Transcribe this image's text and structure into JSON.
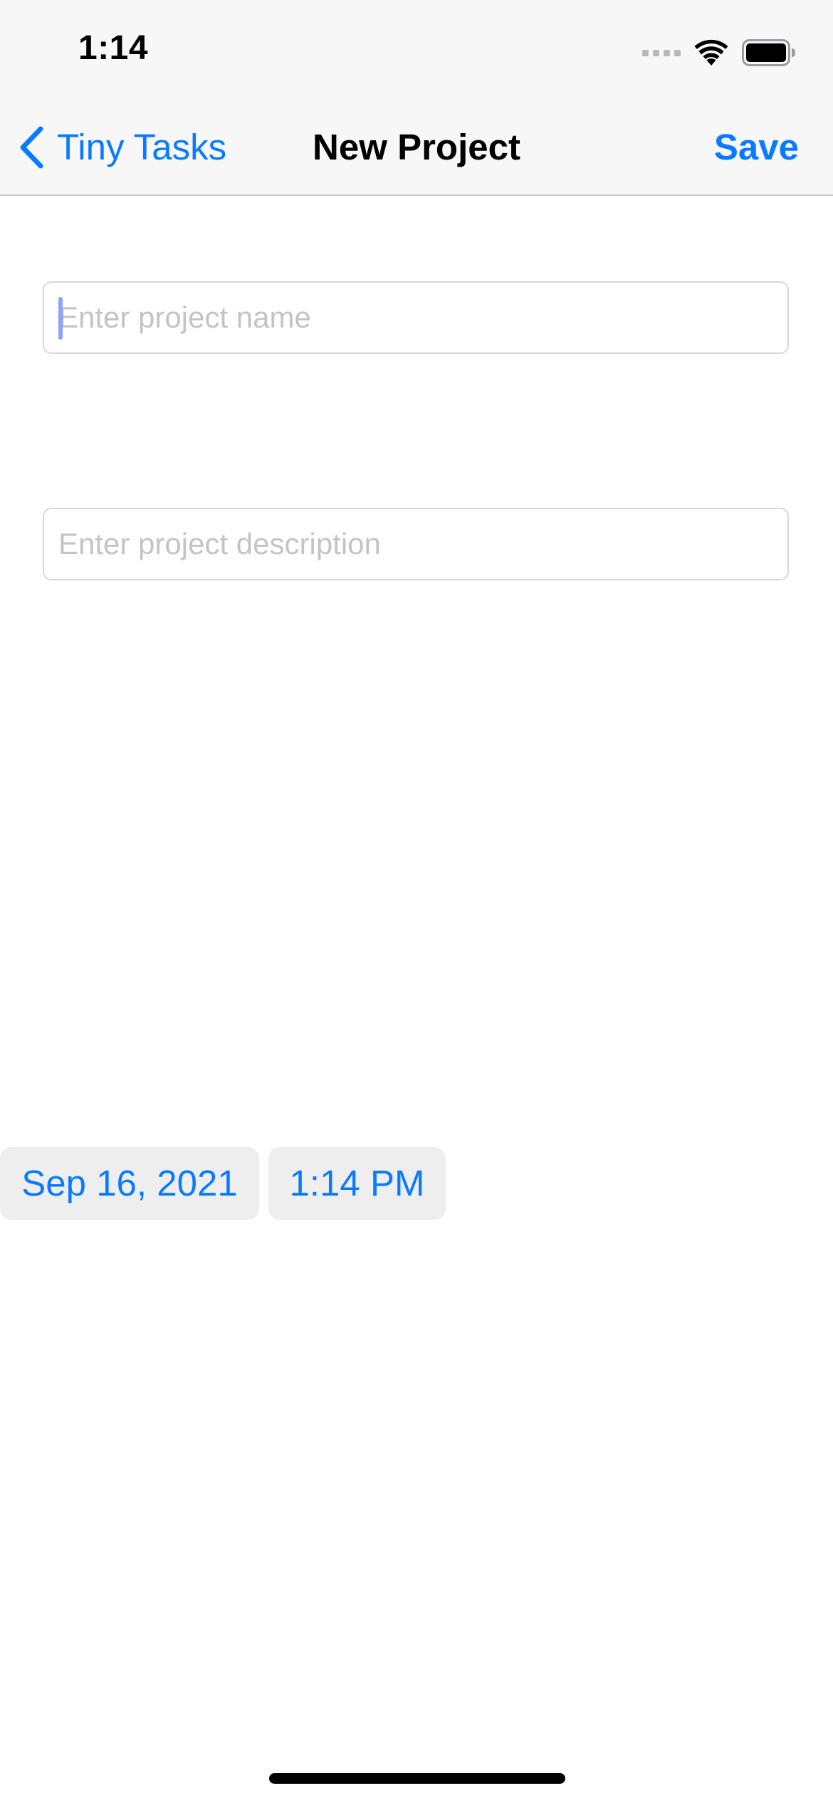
{
  "status_bar": {
    "time": "1:14",
    "icons": [
      "cellular-signal-icon",
      "wifi-icon",
      "battery-icon"
    ]
  },
  "nav": {
    "back_label": "Tiny Tasks",
    "title": "New Project",
    "save_label": "Save"
  },
  "form": {
    "name_placeholder": "Enter project name",
    "name_value": "",
    "description_placeholder": "Enter project description",
    "description_value": "",
    "date": "Sep 16, 2021",
    "time": "1:14 PM"
  },
  "colors": {
    "accent": "#0a7aff",
    "bar_background": "#f7f7f7",
    "pill_background": "#eeeeef",
    "placeholder": "#c4c4c7"
  }
}
